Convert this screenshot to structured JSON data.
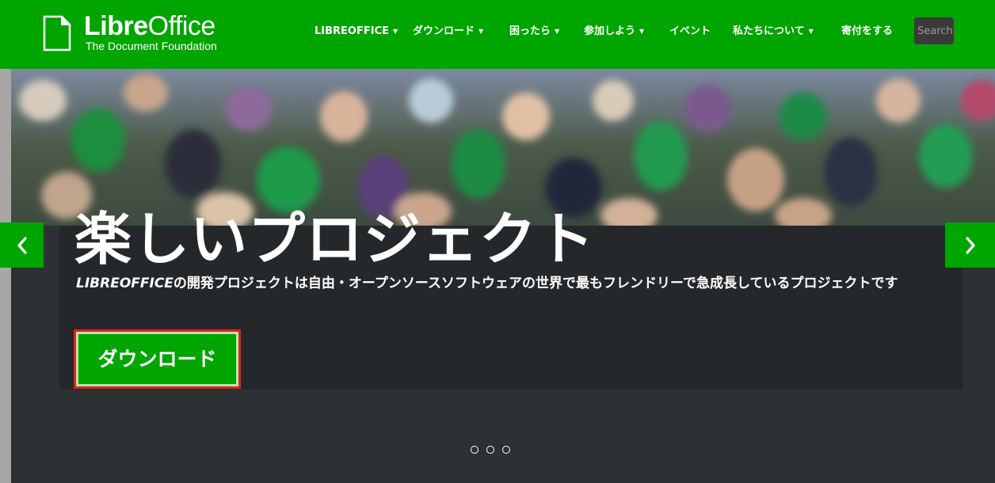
{
  "header": {
    "logo": {
      "name_bold": "Libre",
      "name_regular": "Office",
      "tagline": "The Document Foundation"
    },
    "nav": [
      {
        "label": "LIBREOFFICE",
        "has_dropdown": true
      },
      {
        "label": "ダウンロード",
        "has_dropdown": true
      },
      {
        "label": "困ったら",
        "has_dropdown": true
      },
      {
        "label": "参加しよう",
        "has_dropdown": true
      },
      {
        "label": "イベント",
        "has_dropdown": false
      },
      {
        "label": "私たちについて",
        "has_dropdown": true
      },
      {
        "label": "寄付をする",
        "has_dropdown": false
      }
    ],
    "search": {
      "placeholder": "Search"
    }
  },
  "hero": {
    "headline": "楽しいプロジェクト",
    "subtitle_brand": "LIBREOFFICE",
    "subtitle_rest": "の開発プロジェクトは自由・オープンソースソフトウェアの世界で最もフレンドリーで急成長しているプロジェクトです",
    "download_button": "ダウンロード",
    "prev_icon": "chevron-left-icon",
    "next_icon": "chevron-right-icon",
    "slides": 3
  },
  "colors": {
    "brand_green": "#00a500",
    "dark_panel": "#25282b",
    "background": "#2e3134",
    "highlight_border": "#e2211c"
  }
}
